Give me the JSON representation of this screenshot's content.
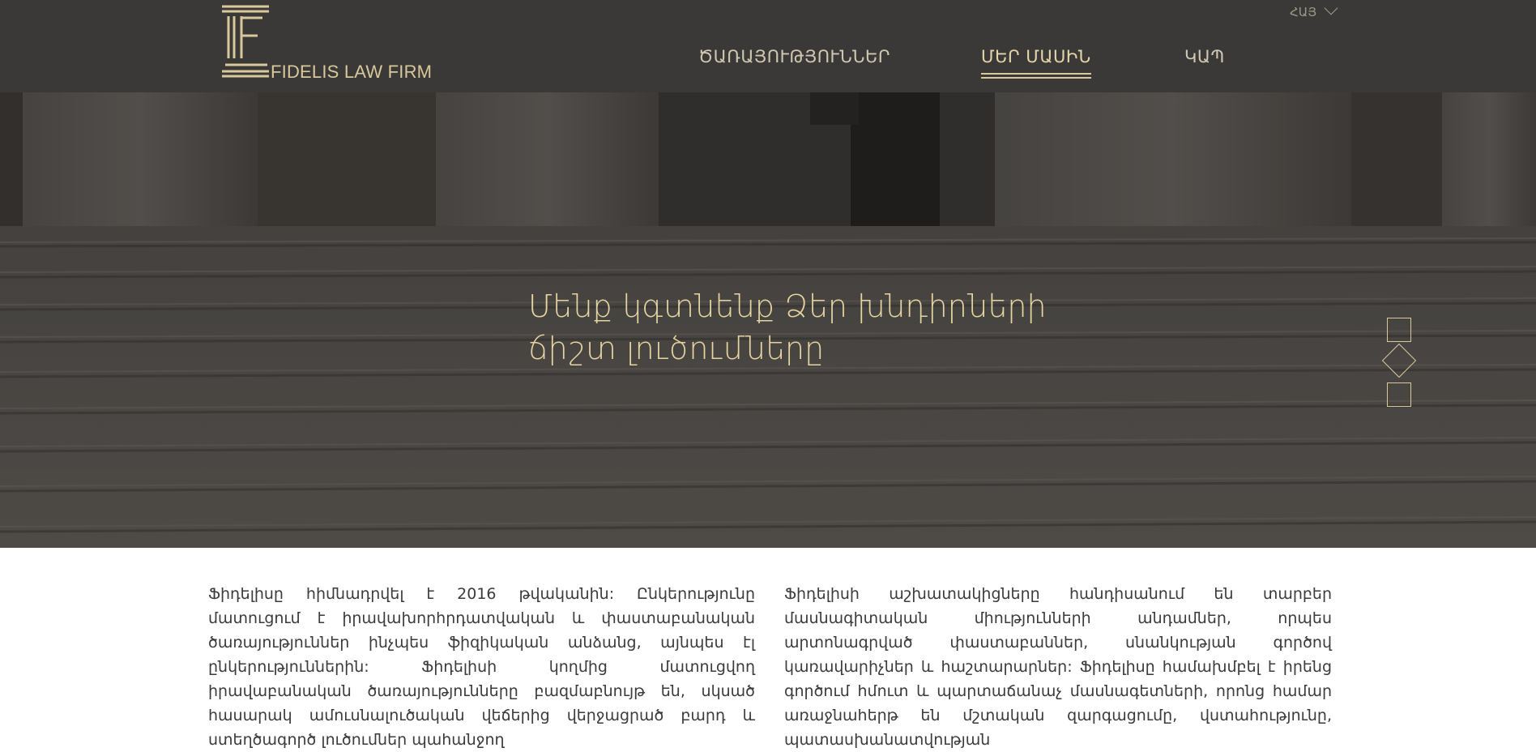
{
  "brand": {
    "name": "FIDELIS LAW FIRM",
    "accent": "#d8c89a"
  },
  "nav": {
    "items": [
      {
        "label": "ԾԱՌԱՅՈՒԹՅՈՒՆՆԵՐ",
        "active": false
      },
      {
        "label": "ՄԵՐ ՄԱՍԻՆ",
        "active": true
      },
      {
        "label": "ԿԱՊ",
        "active": false
      }
    ],
    "language": {
      "label": "ՀԱՅ",
      "icon": "chevron-down-icon"
    }
  },
  "hero": {
    "title_line1": "Մենք կգտնենք Ձեր խնդիրների",
    "title_line2": "ճիշտ լուծումները",
    "controls": [
      "square",
      "diamond",
      "square"
    ],
    "active_slide": 2
  },
  "about": {
    "left": "Ֆիդելիսը հիմնադրվել է 2016 թվականին: Ընկերությունը մատուցում է իրավախորհրդատվական և փաստաբանական ծառայություններ ինչպես ֆիզիկական անձանց, այնպես էլ ընկերություններին: Ֆիդելիսի կողմից մատուցվող իրավաբանական ծառայությունները բազմաբնույթ են, սկսած հասարակ ամուսնալուծական վեճերից վերջացրած բարդ և ստեղծագործ լուծումներ պահանջող",
    "right": "Ֆիդելիսի աշխատակիցները հանդիսանում են տարբեր մասնագիտական միությունների անդամներ, որպես արտոնագրված փաստաբաններ, սնանկության գործով կառավարիչներ և հաշտարարներ: Ֆիդելիսը համախմբել է իրենց գործում հմուտ և պարտաճանաչ մասնագետների, որոնց համար առաջնահերթ են մշտական զարգացումը, վստահությունը, պատասխանատվության"
  }
}
